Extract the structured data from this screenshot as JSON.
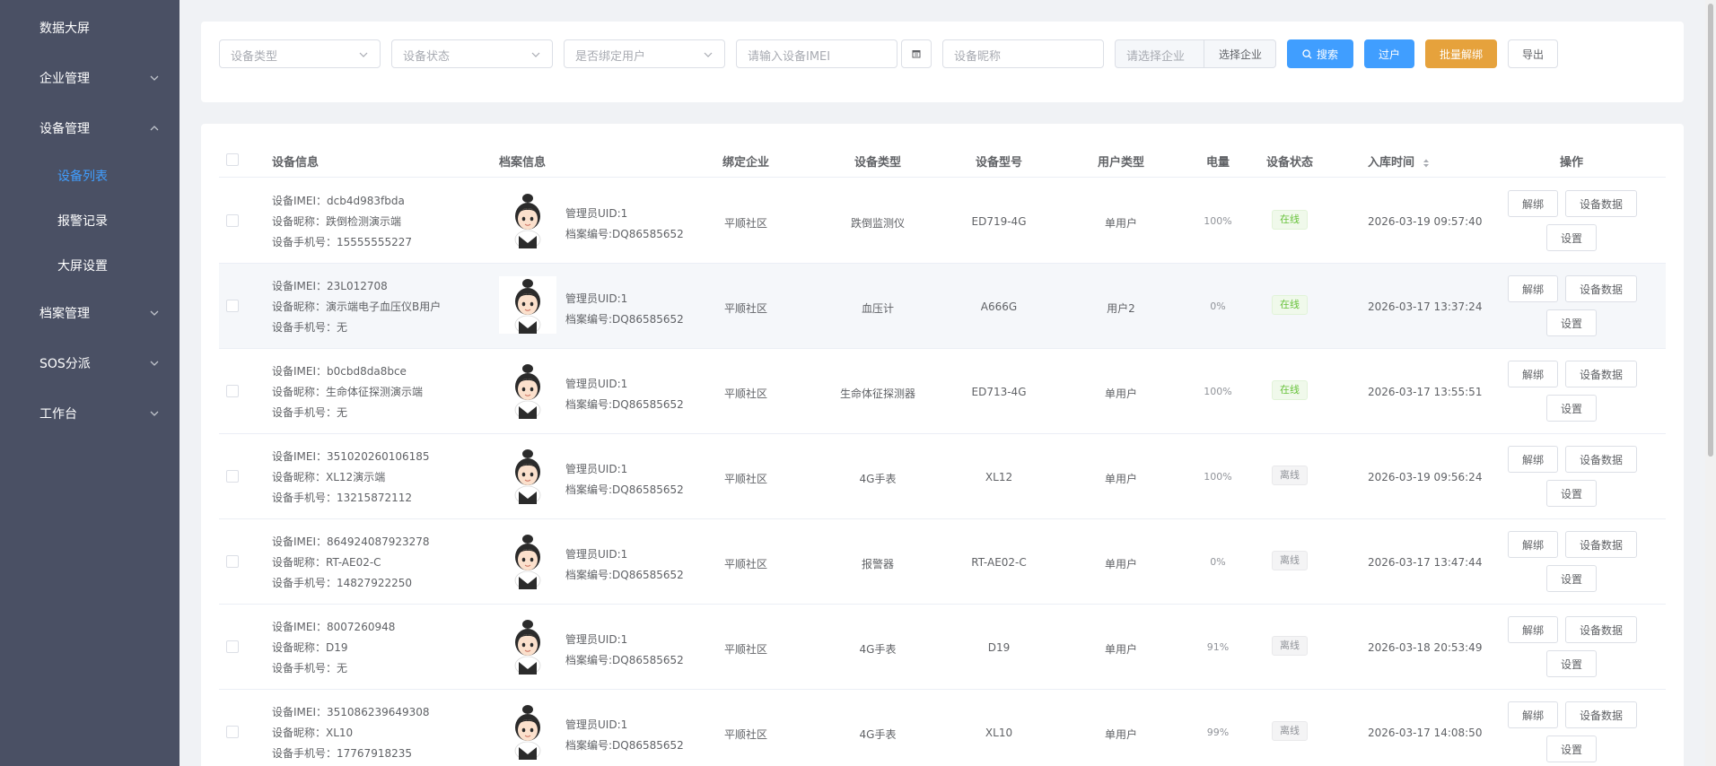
{
  "sidebar": {
    "items": [
      {
        "label": "数据大屏"
      },
      {
        "label": "企业管理"
      },
      {
        "label": "设备管理"
      },
      {
        "label": "设备列表"
      },
      {
        "label": "报警记录"
      },
      {
        "label": "大屏设置"
      },
      {
        "label": "档案管理"
      },
      {
        "label": "SOS分派"
      },
      {
        "label": "工作台"
      }
    ]
  },
  "filters": {
    "device_type_placeholder": "设备类型",
    "device_status_placeholder": "设备状态",
    "bind_user_placeholder": "是否绑定用户",
    "imei_placeholder": "请输入设备IMEI",
    "nickname_placeholder": "设备昵称",
    "enterprise_placeholder": "请选择企业",
    "select_enterprise_label": "选择企业",
    "search_label": "搜索",
    "transfer_label": "过户",
    "batch_unbind_label": "批量解绑",
    "export_label": "导出"
  },
  "table": {
    "headers": {
      "device_info": "设备信息",
      "archive_info": "档案信息",
      "bound_enterprise": "绑定企业",
      "device_type": "设备类型",
      "device_model": "设备型号",
      "user_type": "用户类型",
      "battery": "电量",
      "device_status": "设备状态",
      "storage_time": "入库时间",
      "operations": "操作"
    },
    "labels": {
      "imei": "设备IMEI：",
      "nickname": "设备昵称：",
      "phone": "设备手机号：",
      "admin_uid": "管理员UID:",
      "archive_no": "档案编号:",
      "unbind": "解绑",
      "device_data": "设备数据",
      "settings": "设置"
    },
    "rows": [
      {
        "imei": "dcb4d983fbda",
        "nickname": "跌倒检测演示端",
        "phone": "15555555227",
        "uid": "1",
        "archive": "DQ86585652",
        "enterprise": "平顺社区",
        "type": "跌倒监测仪",
        "model": "ED719-4G",
        "user_type": "单用户",
        "battery": "100%",
        "status": "在线",
        "time": "2026-03-19 09:57:40"
      },
      {
        "imei": "23L012708",
        "nickname": "演示端电子血压仪B用户",
        "phone": "无",
        "uid": "1",
        "archive": "DQ86585652",
        "enterprise": "平顺社区",
        "type": "血压计",
        "model": "A666G",
        "user_type": "用户2",
        "battery": "0%",
        "status": "在线",
        "time": "2026-03-17 13:37:24"
      },
      {
        "imei": "b0cbd8da8bce",
        "nickname": "生命体征探测演示端",
        "phone": "无",
        "uid": "1",
        "archive": "DQ86585652",
        "enterprise": "平顺社区",
        "type": "生命体征探测器",
        "model": "ED713-4G",
        "user_type": "单用户",
        "battery": "100%",
        "status": "在线",
        "time": "2026-03-17 13:55:51"
      },
      {
        "imei": "351020260106185",
        "nickname": "XL12演示端",
        "phone": "13215872112",
        "uid": "1",
        "archive": "DQ86585652",
        "enterprise": "平顺社区",
        "type": "4G手表",
        "model": "XL12",
        "user_type": "单用户",
        "battery": "100%",
        "status": "离线",
        "time": "2026-03-19 09:56:24"
      },
      {
        "imei": "864924087923278",
        "nickname": "RT-AE02-C",
        "phone": "14827922250",
        "uid": "1",
        "archive": "DQ86585652",
        "enterprise": "平顺社区",
        "type": "报警器",
        "model": "RT-AE02-C",
        "user_type": "单用户",
        "battery": "0%",
        "status": "离线",
        "time": "2026-03-17 13:47:44"
      },
      {
        "imei": "8007260948",
        "nickname": "D19",
        "phone": "无",
        "uid": "1",
        "archive": "DQ86585652",
        "enterprise": "平顺社区",
        "type": "4G手表",
        "model": "D19",
        "user_type": "单用户",
        "battery": "91%",
        "status": "离线",
        "time": "2026-03-18 20:53:49"
      },
      {
        "imei": "351086239649308",
        "nickname": "XL10",
        "phone": "17767918235",
        "uid": "1",
        "archive": "DQ86585652",
        "enterprise": "平顺社区",
        "type": "4G手表",
        "model": "XL10",
        "user_type": "单用户",
        "battery": "99%",
        "status": "离线",
        "time": "2026-03-17 14:08:50"
      }
    ]
  },
  "colors": {
    "sidebar_bg": "#4a5064",
    "primary": "#409eff",
    "warning": "#e6a23c",
    "online": "#67c23a",
    "offline": "#909399"
  }
}
